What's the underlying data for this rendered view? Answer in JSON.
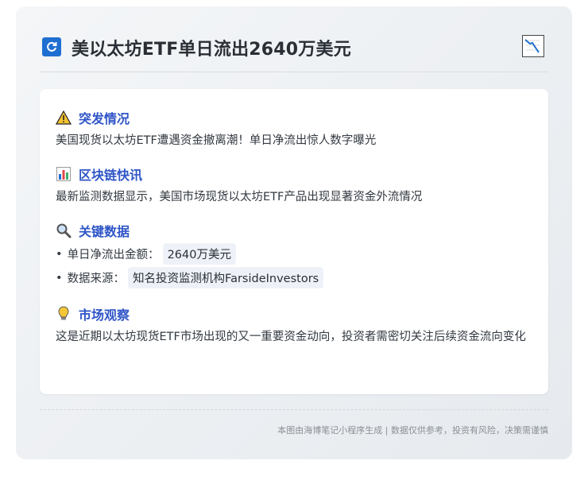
{
  "header": {
    "title": "美以太坊ETF单日流出2640万美元",
    "left_icon": "refresh-icon",
    "right_icon": "chart-down-icon"
  },
  "sections": [
    {
      "icon": "warning-icon",
      "heading": "突发情况",
      "text": "美国现货以太坊ETF遭遇资金撤离潮！单日净流出惊人数字曝光"
    },
    {
      "icon": "bar-chart-icon",
      "heading": "区块链快讯",
      "text": "最新监测数据显示，美国市场现货以太坊ETF产品出现显著资金外流情况"
    },
    {
      "icon": "magnifier-icon",
      "heading": "关键数据",
      "bullets": [
        {
          "label": "单日净流出金额：",
          "value": "2640万美元"
        },
        {
          "label": "数据来源：",
          "value": "知名投资监测机构FarsideInvestors"
        }
      ]
    },
    {
      "icon": "lightbulb-icon",
      "heading": "市场观察",
      "text": "这是近期以太坊现货ETF市场出现的又一重要资金动向，投资者需密切关注后续资金流向变化"
    }
  ],
  "footer": "本图由海博笔记小程序生成 | 数据仅供参考，投资有风险，决策需谨慎",
  "colors": {
    "heading": "#2f55c7",
    "icon_blue": "#1f6fd1",
    "chip_bg": "#eef2f8"
  }
}
